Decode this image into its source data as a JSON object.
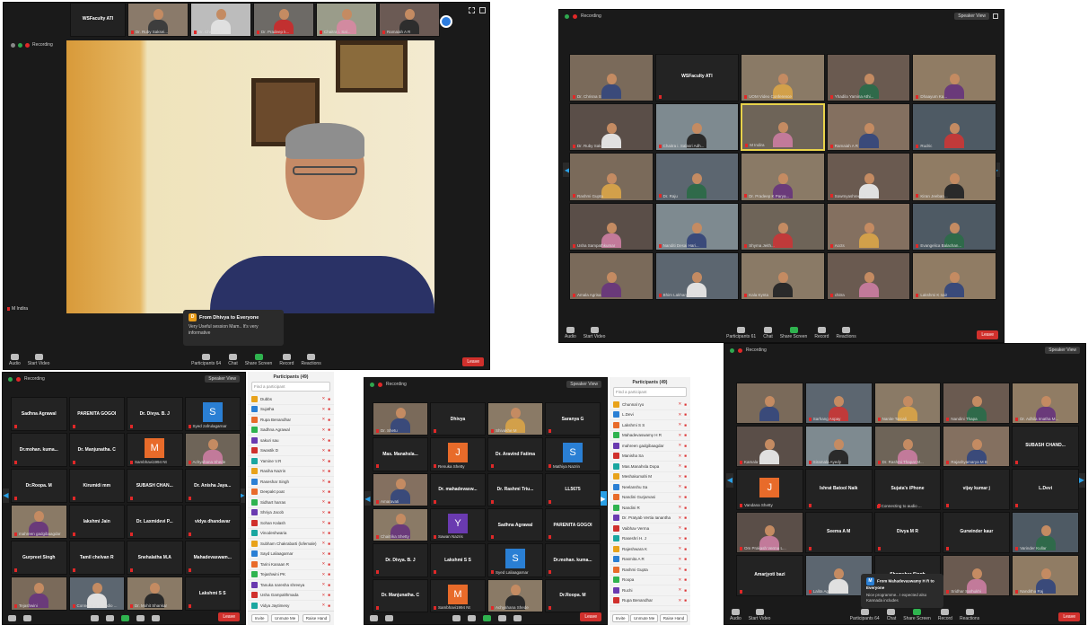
{
  "common": {
    "recording": "Recording",
    "speaker_view": "Speaker View",
    "controls": [
      "Audio",
      "Start Video",
      "Participants",
      "Chat",
      "Share Screen",
      "Record",
      "Reactions"
    ],
    "leave": "Leave"
  },
  "win1": {
    "strip": [
      "WSFaculty ATI",
      "Dr. Ruby Saksei...",
      "Dr. Chrisna S...",
      "Dr. Pradeep k...",
      "Chaitra i. Sal...",
      "Ramaiah A R"
    ],
    "speaker_name": "M Indira",
    "participants_count": "64",
    "chat": {
      "avatar": "D",
      "from": "From Dhivya to Everyone",
      "msg": "Very Useful session Mam.. It's very informative"
    }
  },
  "win2": {
    "tiles": [
      "Dr. Chrisna S",
      "WSFaculty ATI",
      "UOM Video Conference",
      "Yhadila Yamina Athi...",
      "Dhaayum Ka...",
      "Dr. Ruby Saksena",
      "Chaitra i. Salasri Adh...",
      "M Indira",
      "Ramaiah A R",
      "Rudric",
      "Rashmi Gupta",
      "Dr. Raju",
      "Dr. Pradeep K Parya...",
      "Sowmyashree s k",
      "Kiran Jeeban...",
      "Usha Sampathkumar",
      "Nanditi Desai Hari...",
      "Shyma Jeith...",
      "Accts",
      "Evangelica Balachan...",
      "Amala Agrisa",
      "Bhim Lakhargaonkar",
      "Kala Kynta",
      "chitra",
      "Lakshmi K nair"
    ],
    "participants_count": "61"
  },
  "win3": {
    "tiles": [
      "Sadhna Agrawal",
      "PARENITA GOGOI",
      "Dr. Divya. B. J",
      "",
      "Dr.mohan. kuma...",
      "Dr. Manjunatha. C",
      "",
      "",
      "Dr.Roopa. M",
      "Kirumidi mm",
      "SUBASH CHAN...",
      "Dr. Anisha Jaya...",
      "",
      "lakshmi Jain",
      "Dr. Laxmidevi P...",
      "vidya dhandavar",
      "Gurpreet Singh",
      "Tamil chelvan R",
      "Snehalatha M.A",
      "Mahadevaswam...",
      "",
      "Dr.Parimala C.P",
      "",
      "Lakshmi S S"
    ],
    "avatars": {
      "s": "S",
      "m": "M"
    },
    "sublabels": [
      "Syed zafrulagarnar",
      "Sambhavi1994 Nt",
      "Achyahana Shede",
      "mahreen gadgibaagdar",
      "Tejashwini",
      "Connecting to audio ...",
      "Dr. Mohit Shankar"
    ],
    "participants_title": "Participants (49)",
    "find": "Find a participant",
    "list": [
      "Dubbs",
      "Sujatha",
      "Rupa Benandhar",
      "Sadhna Agrawal",
      "sakuri sau",
      "Swastik D",
      "Yamine V.R",
      "Rasiha Nazrin",
      "Raseshar Singh",
      "Deepakt poat",
      "Sidhart harras",
      "Shriya Jacob",
      "Sohan Kalash",
      "Vinodeshwaria",
      "Subham Chakrabarti (lofemale)",
      "Sayd Laliaagarnar",
      "Tarini Kanaan R",
      "Tejashwini PK",
      "Tanuka naresha shreeya",
      "Usha Gampalthmada",
      "Vidya Jaytimesy"
    ],
    "footer": [
      "Invite",
      "Unmute Me",
      "Raise Hand"
    ]
  },
  "win4": {
    "tiles": [
      "",
      "Dhivya",
      "",
      "Saranya G",
      "Mas. Manahsla...",
      "",
      "Dr. Aravind Fatima",
      "",
      "",
      "Dr. mahadevasw...",
      "Dr. Rashmi Triu...",
      "LL5675",
      "",
      "",
      "Sadhna Agrawal",
      "PARENITA GOGOI",
      "Dr. Divya. B. J",
      "Lakshmi S S",
      "",
      "Dr.mohan. kuma...",
      "Dr. Manjunatha. C",
      "",
      "",
      "Dr.Roopa. M"
    ],
    "avatars": {
      "j": "J",
      "s": "S",
      "y": "Y",
      "s2": "S",
      "m": "M"
    },
    "sublabels": [
      "Dr. Shetu",
      "Shivakhe M",
      "Renuka Shetty",
      "Mathiya Nazrin",
      "Amaravati",
      "Chaitrika Shetty",
      "Sawan Nazris",
      "Syed Laliaagarnar",
      "Sambhavi1994 Nt",
      "Achyahana Shede"
    ],
    "participants_title": "Participants (49)",
    "find": "Find a participant",
    "list": [
      "Chunnal ryo",
      "L.Devi",
      "Lakshmi S S",
      "Mahadevaswamy H R",
      "mahreen gadgibaagdar",
      "Manisha Sa",
      "Mas.Manahsla Dopa",
      "Meshakumahi M",
      "Neelanshu Sa",
      "Nandini Gurjarvasi",
      "Nandini R",
      "Dr. Pratyab Vertia Ianantha",
      "Vaibhav Verma",
      "Raseshri H. J",
      "Rajeshwara K",
      "Rasmita A R",
      "Rashmi Gupta",
      "Roopa",
      "Ruchi",
      "Rupa Benandhar"
    ],
    "footer": [
      "Invite",
      "Unmute Me",
      "Raise Hand"
    ]
  },
  "win5": {
    "tiles": [
      "",
      "Sarhang Aspay",
      "Nanite Tarcali",
      "Nandini Thapa",
      "Dr. Adhila Imatha M...",
      "Kamala Tankeras",
      "Siramala Ayedy",
      "Dr. Rashmi Thapat M...",
      "Rajashyamarya M B",
      "SUBASH CHAND...",
      "",
      "Ishrat Batool Naik",
      "Sujata's iPhone",
      "vijay kumar j",
      "L.Devi",
      "Om Prakash Verma L...",
      "Seema A M",
      "Divya M R",
      "Gurwinder kaur",
      "Varinder Kullar",
      "Amarjyoti bazi",
      "Lalita Agrawal",
      "Shamsher Singh",
      "Sridhar Sarhukhi",
      "Nanditha Raj"
    ],
    "avatar_j": "J",
    "extra": [
      "Vandana Shetty",
      "Connecting to audio ..."
    ],
    "participants_count": "64",
    "chat": {
      "avatar": "M",
      "from": "From Mahadevaswamy H R to Everyone",
      "msg": "Nice programme.. I expected also Kannada includes"
    }
  }
}
